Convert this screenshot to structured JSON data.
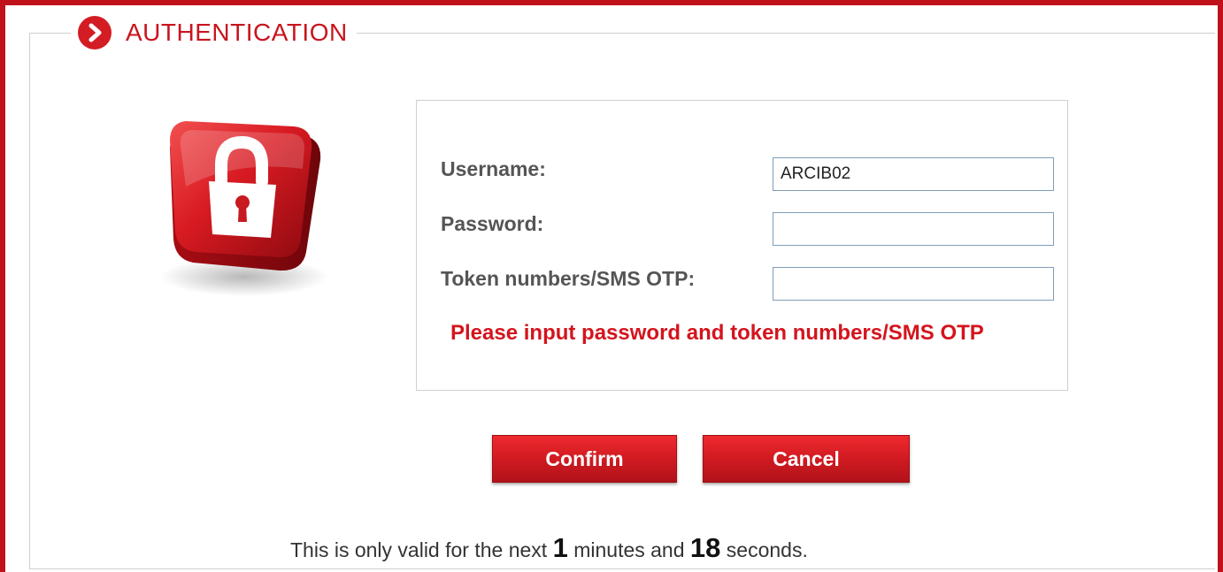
{
  "section": {
    "title": "AUTHENTICATION"
  },
  "form": {
    "username_label": "Username:",
    "username_value": "ARCIB02",
    "password_label": "Password:",
    "password_value": "",
    "token_label": "Token numbers/SMS OTP:",
    "token_value": "",
    "error_message": "Please input password and token numbers/SMS OTP"
  },
  "actions": {
    "confirm_label": "Confirm",
    "cancel_label": "Cancel"
  },
  "timer": {
    "prefix": "This is only valid for the next",
    "minutes": "1",
    "middle": "minutes and",
    "seconds": "18",
    "suffix": "seconds."
  },
  "icons": {
    "section_icon": "chevron-right-circle-icon",
    "security_icon": "padlock-icon"
  },
  "colors": {
    "brand_red": "#c0121b",
    "error_red": "#d4141d",
    "input_border": "#7f9db9"
  }
}
